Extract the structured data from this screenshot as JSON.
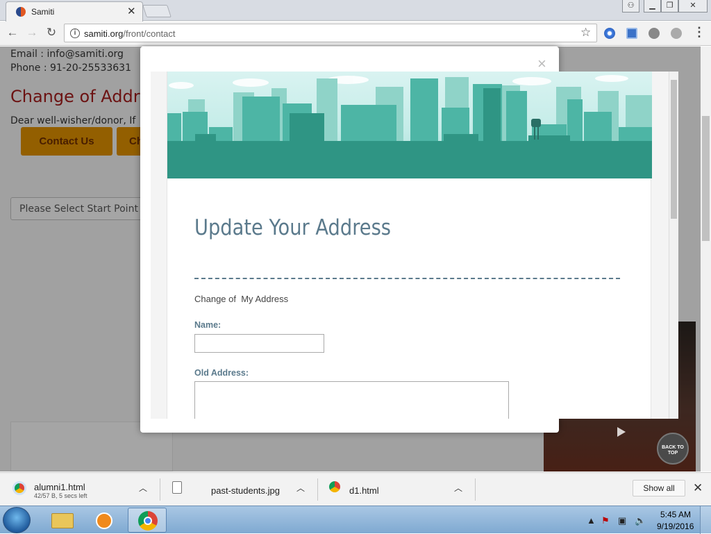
{
  "browser": {
    "tab_title": "Samiti",
    "tab_close": "✕",
    "url_domain": "samiti.org",
    "url_path": "/front/contact",
    "window_controls": [
      "⚇",
      "▁",
      "❐",
      "✕"
    ]
  },
  "page": {
    "email": "Email : info@samiti.org",
    "phone": "Phone : 91-20-25533631",
    "title": "Change of Addr",
    "intro": "Dear well-wisher/donor, If",
    "contact_button": "Contact Us",
    "second_button": "Ch",
    "select_placeholder": "Please Select Start Point",
    "back_to_top": "BACK TO TOP"
  },
  "modal": {
    "close": "×",
    "form_title": "Update Your Address",
    "form_description": "Change of  My Address",
    "name_label": "Name:",
    "old_address_label": "Old Address:"
  },
  "downloads": {
    "items": [
      {
        "name": "alumni1.html",
        "status": "42/57 B, 5 secs left"
      },
      {
        "name": "past-students.jpg",
        "status": ""
      },
      {
        "name": "d1.html",
        "status": ""
      }
    ],
    "show_all": "Show all",
    "close": "✕"
  },
  "taskbar": {
    "time": "5:45 AM",
    "date": "9/19/2016"
  },
  "colors": {
    "accent_title": "#a01c1c",
    "button_orange": "#d98c00",
    "form_blue_gray": "#5b7a8c",
    "banner_teal": "#3aa592"
  }
}
